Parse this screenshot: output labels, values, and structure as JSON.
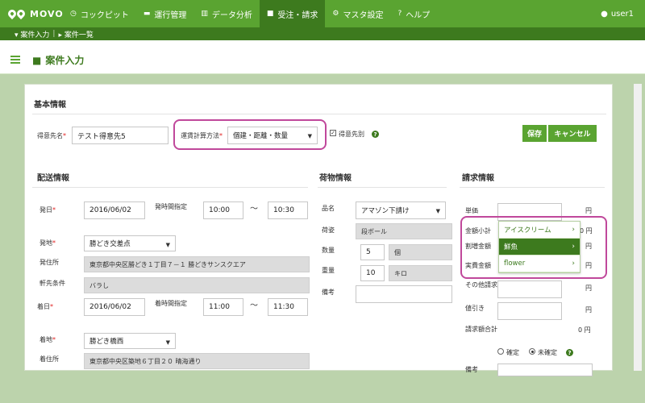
{
  "app": {
    "brand": "MOVO"
  },
  "nav": [
    {
      "icon": "◷",
      "label": "コックピット"
    },
    {
      "icon": "▬",
      "label": "運行管理"
    },
    {
      "icon": "▥",
      "label": "データ分析"
    },
    {
      "icon": "■",
      "label": "受注・請求"
    },
    {
      "icon": "⚙",
      "label": "マスタ設定"
    },
    {
      "icon": "?",
      "label": "ヘルプ"
    }
  ],
  "user": {
    "icon": "●",
    "name": "user1"
  },
  "breadcrumb": [
    "▾ 案件入力",
    "▸ 案件一覧"
  ],
  "page": {
    "title": "案件入力"
  },
  "basic": {
    "section": "基本情報",
    "customer_label": "得意先名",
    "customer_value": "テスト得意先5",
    "fare_label": "運賃計算方法",
    "fare_value": "個建・距離・数量",
    "customer_flag_label": "得意先別",
    "required_mark": "*"
  },
  "actions": {
    "save": "保存",
    "cancel": "キャンセル"
  },
  "shipping": {
    "section": "配送情報",
    "depart_date_label": "発日",
    "depart_date": "2016/06/02",
    "depart_time_label": "発時間指定",
    "depart_time_from": "10:00",
    "depart_time_to": "10:30",
    "tilde": "～",
    "origin_label": "発地",
    "origin_value": "勝どき交差点",
    "origin_addr_label": "発住所",
    "origin_addr": "東京都中央区勝どき１丁目７－１ 勝どきサンスクエア",
    "eave_label": "軒先条件",
    "eave_value": "バラし",
    "arrive_date_label": "着日",
    "arrive_date": "2016/06/02",
    "arrive_time_label": "着時間指定",
    "arrive_time_from": "11:00",
    "arrive_time_to": "11:30",
    "dest_label": "着地",
    "dest_value": "勝どき橋西",
    "dest_addr_label": "着住所",
    "dest_addr": "東京都中央区築地６丁目２０ 晴海通り"
  },
  "cargo": {
    "section": "荷物情報",
    "item_label": "品名",
    "item_value": "アマゾン下請け",
    "pack_label": "荷姿",
    "pack_value": "段ボール",
    "qty_label": "数量",
    "qty_value": "5",
    "qty_unit": "個",
    "weight_label": "重量",
    "weight_value": "10",
    "weight_unit": "キロ",
    "note_label": "備考"
  },
  "billing": {
    "section": "請求情報",
    "unit_price_label": "単価",
    "subtotal_label": "金額小計",
    "surcharge_label": "割増金額",
    "actual_label": "実費金額",
    "other_label": "その他請求",
    "discount_label": "値引き",
    "total_label": "請求額合計",
    "total_value": "0",
    "yen": "円",
    "confirmed": "確定",
    "unconfirmed": "未確定",
    "note_label": "備考"
  },
  "dropdown": {
    "items": [
      {
        "label": "アイスクリーム",
        "selected": false
      },
      {
        "label": "鮮魚",
        "selected": true
      },
      {
        "label": "flower",
        "selected": false
      }
    ],
    "chevron": "›"
  },
  "colors": {
    "primary": "#5aa431",
    "primary_dark": "#3d7a1e",
    "highlight": "#c0489b"
  }
}
